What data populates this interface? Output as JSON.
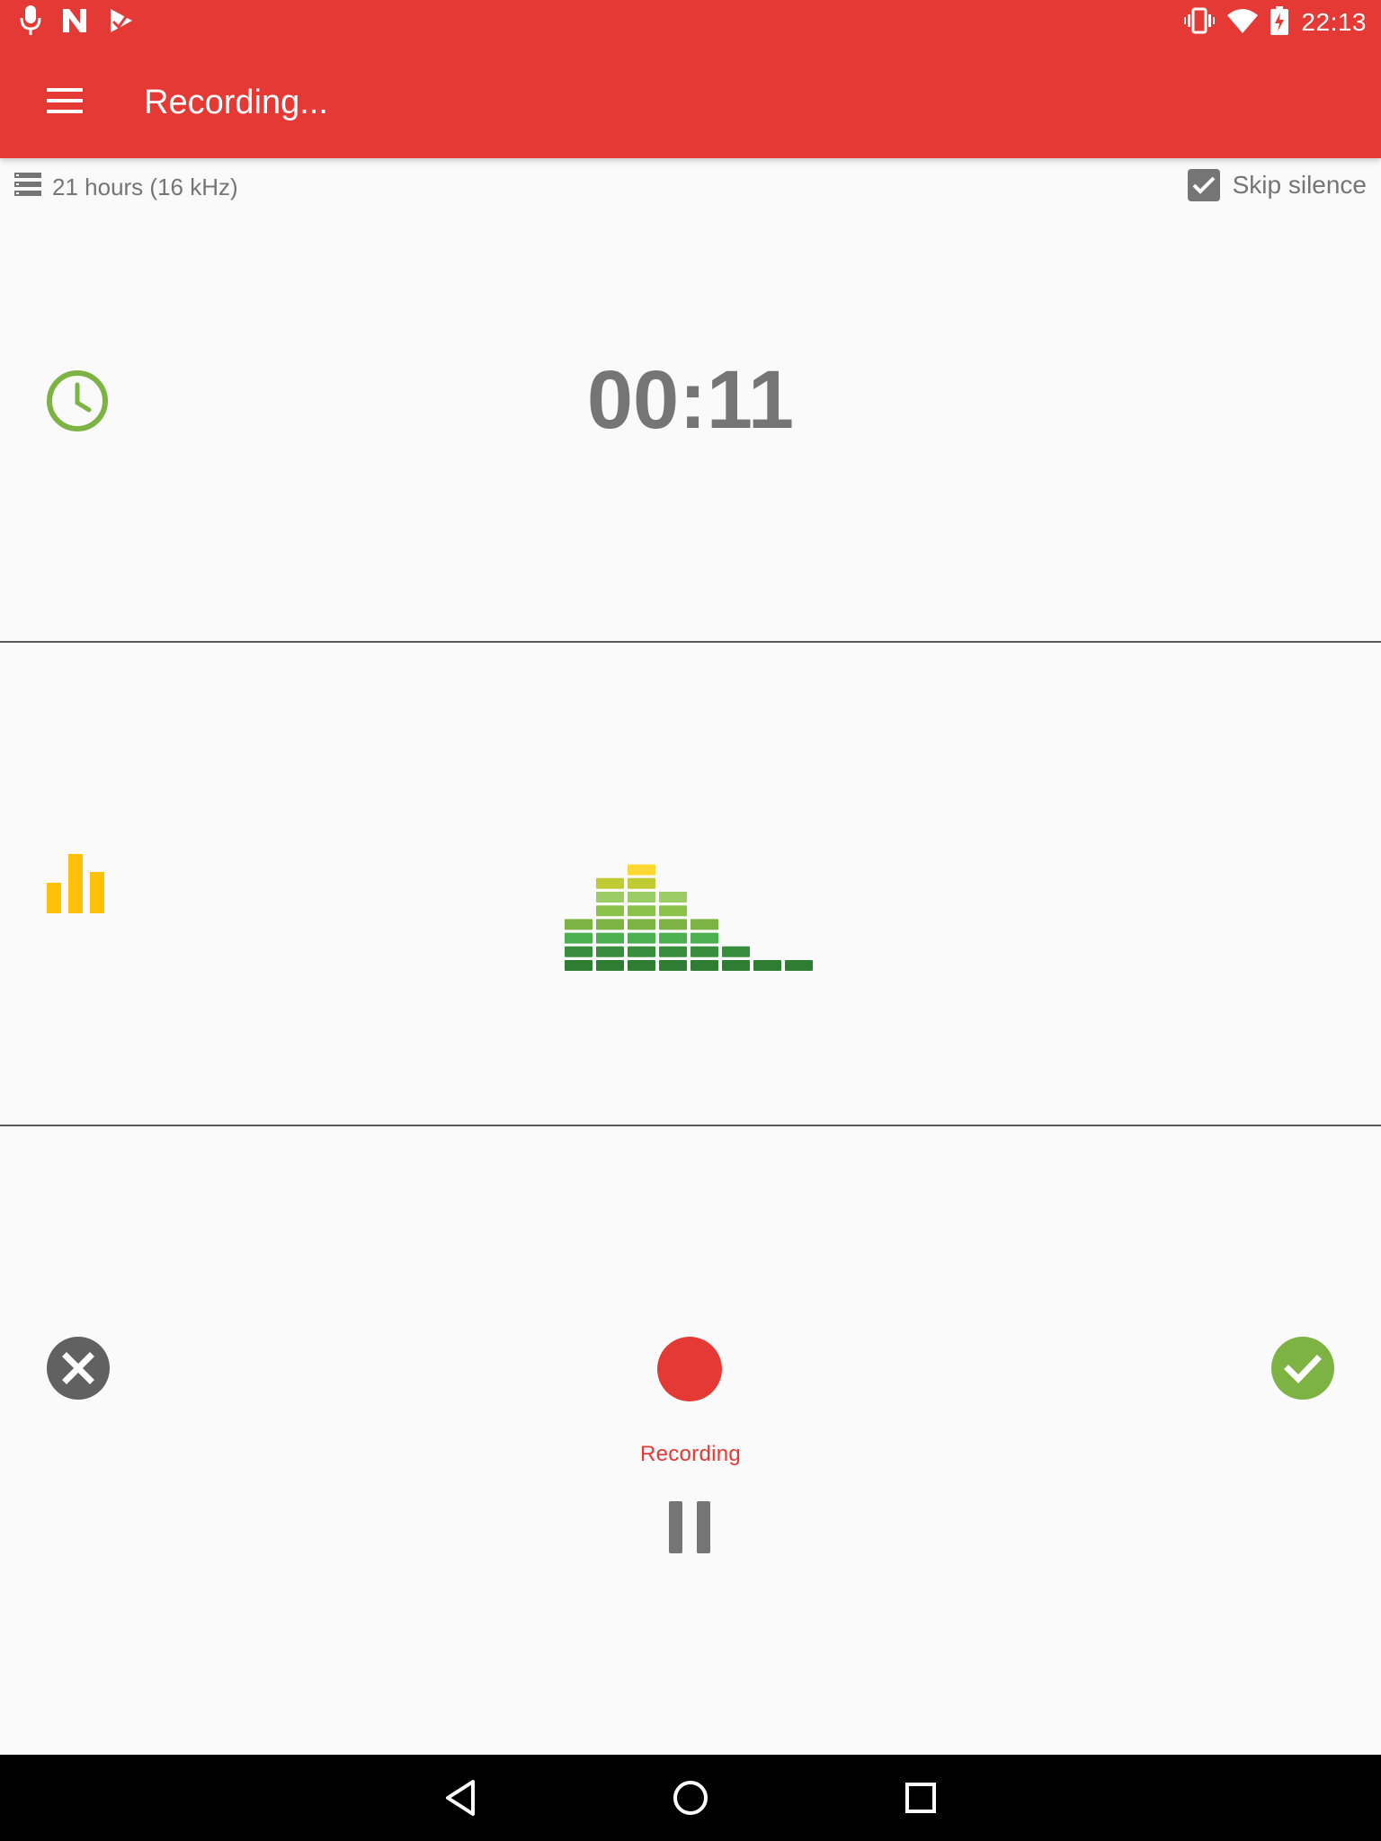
{
  "status_bar": {
    "time": "22:13",
    "left_icons": [
      "mic-icon",
      "n-app-icon",
      "play-store-icon"
    ],
    "right_icons": [
      "vibrate-icon",
      "wifi-icon",
      "battery-charging-icon"
    ]
  },
  "app_bar": {
    "title": "Recording...",
    "menu_icon": "hamburger-menu-icon",
    "background_color": "#e53935"
  },
  "info": {
    "storage_text": "21 hours (16 kHz)",
    "skip_silence_label": "Skip silence",
    "skip_silence_checked": true
  },
  "timer": {
    "value": "00:11",
    "icon": "clock-icon",
    "icon_color": "#7cb342"
  },
  "level": {
    "icon": "bar-chart-icon",
    "icon_color": "#ffc107",
    "meter_bar_heights": [
      4,
      7,
      8,
      6,
      4,
      2,
      1,
      1
    ],
    "meter_max_segments": 9
  },
  "controls": {
    "cancel_icon": "cancel-icon",
    "record_label": "Recording",
    "record_color": "#e53935",
    "pause_icon": "pause-icon",
    "done_icon": "check-icon",
    "done_color": "#7cb342"
  },
  "nav_bar": {
    "buttons": [
      "back-icon",
      "home-icon",
      "recents-icon"
    ]
  }
}
